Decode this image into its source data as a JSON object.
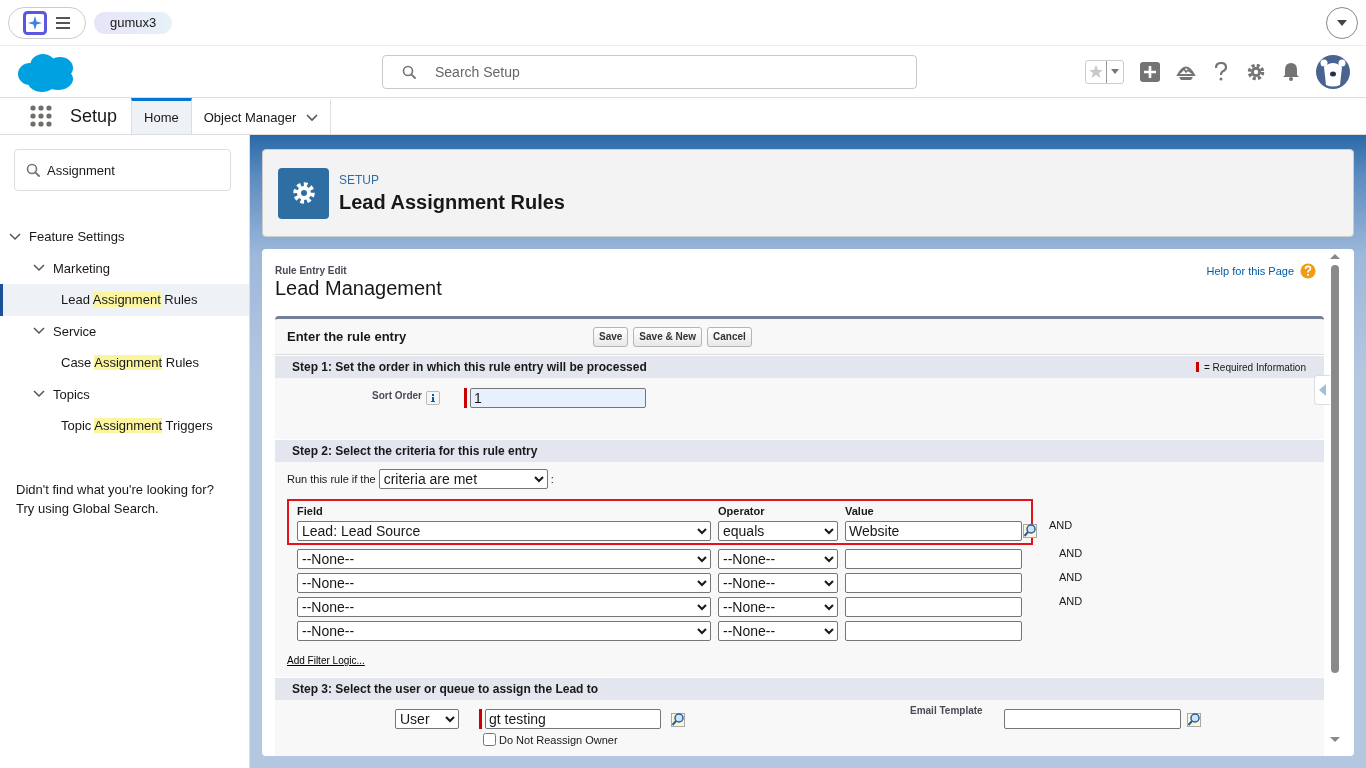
{
  "browser_bar": {
    "tab": "gumux3"
  },
  "header": {
    "search": {
      "placeholder": "Search Setup"
    }
  },
  "nav": {
    "app": "Setup",
    "tabs": [
      {
        "label": "Home",
        "selected": true,
        "menu": false
      },
      {
        "label": "Object Manager",
        "selected": false,
        "menu": true
      }
    ]
  },
  "sidebar": {
    "search": {
      "value": "Assignment"
    },
    "tree": [
      {
        "label": [
          {
            "text": "Feature Settings",
            "highlight": false
          }
        ],
        "expanded": true,
        "selected": false,
        "children": [
          {
            "label": [
              {
                "text": "Marketing",
                "highlight": false
              }
            ],
            "expanded": true,
            "selected": false,
            "children": [
              {
                "label": [
                  {
                    "text": "Lead ",
                    "highlight": false
                  },
                  {
                    "text": "Assignment",
                    "highlight": true
                  },
                  {
                    "text": " Rules",
                    "highlight": false
                  }
                ],
                "selected": true
              }
            ]
          },
          {
            "label": [
              {
                "text": "Service",
                "highlight": false
              }
            ],
            "expanded": true,
            "selected": false,
            "children": [
              {
                "label": [
                  {
                    "text": "Case ",
                    "highlight": false
                  },
                  {
                    "text": "Assignment",
                    "highlight": true
                  },
                  {
                    "text": " Rules",
                    "highlight": false
                  }
                ],
                "selected": false
              }
            ]
          },
          {
            "label": [
              {
                "text": "Topics",
                "highlight": false
              }
            ],
            "expanded": true,
            "selected": false,
            "children": [
              {
                "label": [
                  {
                    "text": "Topic ",
                    "highlight": false
                  },
                  {
                    "text": "Assignment",
                    "highlight": true
                  },
                  {
                    "text": " Triggers",
                    "highlight": false
                  }
                ],
                "selected": false
              }
            ]
          }
        ]
      }
    ],
    "help_text": [
      "Didn't find what you're looking for?",
      "Try using Global Search."
    ]
  },
  "page_header": {
    "eyebrow": "SETUP",
    "title": "Lead Assignment Rules"
  },
  "content": {
    "subtitle": "Rule Entry Edit",
    "title": "Lead Management",
    "help_link": "Help for this Page",
    "form": {
      "title": "Enter the rule entry",
      "buttons": [
        "Save",
        "Save & New",
        "Cancel"
      ],
      "required_legend": "= Required Information",
      "step1": {
        "title": "Step 1: Set the order in which this rule entry will be processed",
        "sort_order": {
          "label": "Sort Order",
          "value": "1",
          "required": true
        }
      },
      "step2": {
        "title": "Step 2: Select the criteria for this rule entry",
        "run_if": {
          "label": "Run this rule if the",
          "value": "criteria are met",
          "suffix": ":"
        },
        "columns": [
          "Field",
          "Operator",
          "Value"
        ],
        "rows": [
          {
            "field": "Lead: Lead Source",
            "operator": "equals",
            "value": "Website",
            "lookup": true,
            "connector": "AND",
            "highlighted": true
          },
          {
            "field": "--None--",
            "operator": "--None--",
            "lookup": false,
            "connector": "AND",
            "highlighted": false
          },
          {
            "field": "--None--",
            "operator": "--None--",
            "lookup": false,
            "connector": "AND",
            "highlighted": false
          },
          {
            "field": "--None--",
            "operator": "--None--",
            "lookup": false,
            "connector": "AND",
            "highlighted": false
          },
          {
            "field": "--None--",
            "operator": "--None--",
            "lookup": false,
            "highlighted": false
          }
        ],
        "filter_logic_link": "Add Filter Logic..."
      },
      "step3": {
        "title": "Step 3: Select the user or queue to assign the Lead to",
        "assignee_type": "User",
        "assignee": {
          "value": "gt testing",
          "required": true
        },
        "email_template": {
          "label": "Email Template"
        },
        "do_not_reassign": {
          "label": "Do Not Reassign Owner",
          "checked": false
        }
      }
    }
  }
}
